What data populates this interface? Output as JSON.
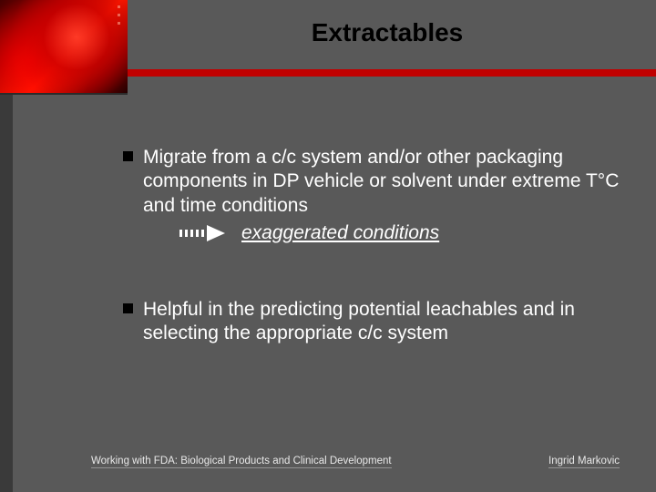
{
  "title": "Extractables",
  "bullets": [
    {
      "text": "Migrate from a c/c system and/or other packaging components in DP vehicle or solvent under extreme T°C and time conditions",
      "sub_em": "exaggerated conditions"
    },
    {
      "text": "Helpful in the predicting potential leachables and in selecting the appropriate c/c system"
    }
  ],
  "footer": {
    "left": "Working with FDA: Biological Products and Clinical Development",
    "right": "Ingrid Markovic"
  }
}
